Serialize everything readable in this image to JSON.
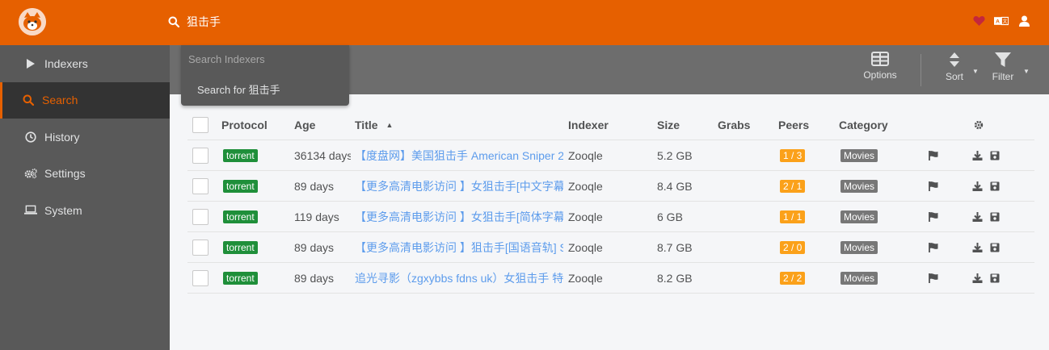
{
  "header": {
    "search_query": "狙击手"
  },
  "sidebar": {
    "items": [
      {
        "label": "Indexers",
        "icon": "play-icon"
      },
      {
        "label": "Search",
        "icon": "search-icon",
        "active": true
      },
      {
        "label": "History",
        "icon": "history-icon"
      },
      {
        "label": "Settings",
        "icon": "cogs-icon"
      },
      {
        "label": "System",
        "icon": "laptop-icon"
      }
    ]
  },
  "toolbar": {
    "options_label": "Options",
    "sort_label": "Sort",
    "filter_label": "Filter"
  },
  "dropdown": {
    "placeholder": "Search Indexers",
    "item": "Search for 狙击手"
  },
  "table": {
    "columns": {
      "protocol": "Protocol",
      "age": "Age",
      "title": "Title",
      "indexer": "Indexer",
      "size": "Size",
      "grabs": "Grabs",
      "peers": "Peers",
      "category": "Category"
    },
    "rows": [
      {
        "protocol": "torrent",
        "age": "36134 days",
        "title": "【度盘网】美国狙击手 American Sniper 2",
        "indexer": "Zooqle",
        "size": "5.2 GB",
        "peers": "1 / 3",
        "category": "Movies"
      },
      {
        "protocol": "torrent",
        "age": "89 days",
        "title": "【更多高清电影访问 】女狙击手[中文字幕",
        "indexer": "Zooqle",
        "size": "8.4 GB",
        "peers": "2 / 1",
        "category": "Movies"
      },
      {
        "protocol": "torrent",
        "age": "119 days",
        "title": "【更多高清电影访问 】女狙击手[简体字幕",
        "indexer": "Zooqle",
        "size": "6 GB",
        "peers": "1 / 1",
        "category": "Movies"
      },
      {
        "protocol": "torrent",
        "age": "89 days",
        "title": "【更多高清电影访问 】狙击手[国语音轨] S",
        "indexer": "Zooqle",
        "size": "8.7 GB",
        "peers": "2 / 0",
        "category": "Movies"
      },
      {
        "protocol": "torrent",
        "age": "89 days",
        "title": "追光寻影（zgxybbs fdns uk）女狙击手 特",
        "indexer": "Zooqle",
        "size": "8.2 GB",
        "peers": "2 / 2",
        "category": "Movies"
      }
    ]
  },
  "colors": {
    "accent": "#e66000",
    "sidebar": "#595959",
    "toolbar": "#6d6d6d",
    "link": "#5d9cec",
    "torrent_badge": "#1f8f3a",
    "peers_badge": "#fba11a"
  }
}
